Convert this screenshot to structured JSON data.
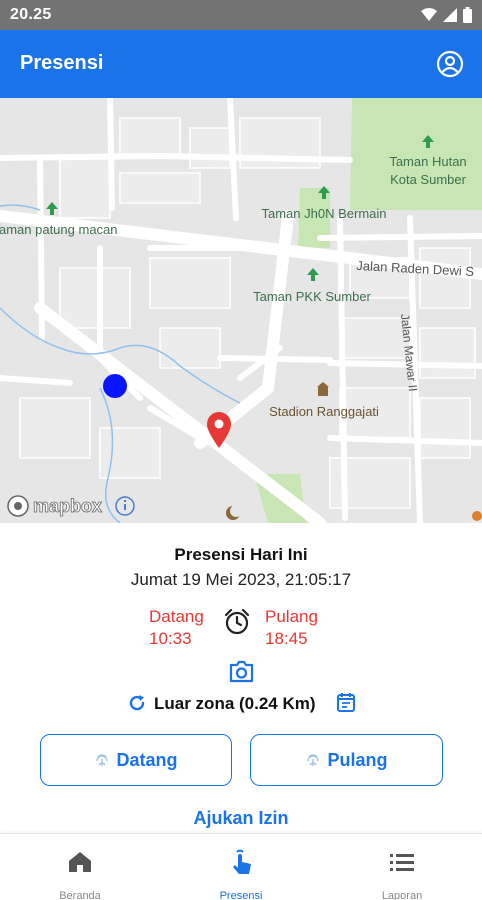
{
  "status_bar": {
    "time": "20.25"
  },
  "app_bar": {
    "title": "Presensi"
  },
  "map": {
    "labels": {
      "taman_hutan_1": "Taman Hutan",
      "taman_hutan_2": "Kota Sumber",
      "taman_jh0n": "Taman Jh0N Bermain",
      "taman_patung": "Taman patung macan",
      "jalan_raden": "Jalan Raden Dewi S",
      "taman_pkk": "Taman PKK Sumber",
      "jalan_mawar": "Jalan Mawar II",
      "stadion": "Stadion Ranggajati"
    },
    "attribution": "mapbox"
  },
  "attendance": {
    "title": "Presensi Hari Ini",
    "datetime": "Jumat 19 Mei 2023, 21:05:17",
    "datang_label": "Datang",
    "datang_time": "10:33",
    "pulang_label": "Pulang",
    "pulang_time": "18:45",
    "zone_status": "Luar zona (0.24 Km)"
  },
  "buttons": {
    "datang": "Datang",
    "pulang": "Pulang"
  },
  "izin_link": "Ajukan Izin",
  "bottom_nav": {
    "items": [
      {
        "label": "Beranda",
        "icon": "home-icon"
      },
      {
        "label": "Presensi",
        "icon": "touch-icon"
      },
      {
        "label": "Laporan",
        "icon": "list-icon"
      }
    ],
    "active": "Presensi"
  },
  "colors": {
    "primary": "#1a73e8",
    "status_bar": "#737373",
    "accent_red": "#e53935",
    "map_bg": "#e6e6e6",
    "park": "#c8e6b4"
  }
}
